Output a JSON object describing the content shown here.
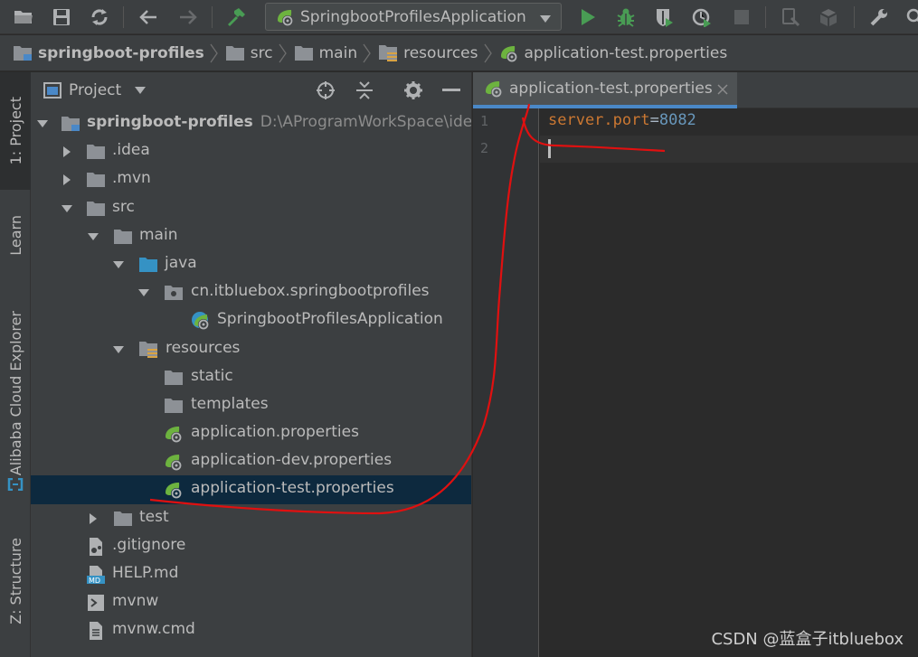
{
  "toolbar": {
    "run_config": "SpringbootProfilesApplication"
  },
  "breadcrumb": [
    "springboot-profiles",
    "src",
    "main",
    "resources",
    "application-test.properties"
  ],
  "tool_stripe": {
    "project_tab": "1: Project",
    "learn_tab": "Learn",
    "alibaba_tab": "Alibaba Cloud Explorer",
    "structure_tab": "Z: Structure"
  },
  "project_panel": {
    "title": "Project",
    "tree": [
      {
        "label": "springboot-profiles",
        "path": "D:\\AProgramWorkSpace\\idea\\s",
        "icon": "module-folder-icon"
      },
      {
        "label": ".idea",
        "icon": "folder-icon"
      },
      {
        "label": ".mvn",
        "icon": "folder-icon"
      },
      {
        "label": "src",
        "icon": "folder-icon"
      },
      {
        "label": "main",
        "icon": "folder-icon"
      },
      {
        "label": "java",
        "icon": "source-folder-icon"
      },
      {
        "label": "cn.itbluebox.springbootprofiles",
        "icon": "package-icon"
      },
      {
        "label": "SpringbootProfilesApplication",
        "icon": "spring-boot-class-icon"
      },
      {
        "label": "resources",
        "icon": "resources-folder-icon"
      },
      {
        "label": "static",
        "icon": "folder-icon"
      },
      {
        "label": "templates",
        "icon": "folder-icon"
      },
      {
        "label": "application.properties",
        "icon": "spring-properties-icon"
      },
      {
        "label": "application-dev.properties",
        "icon": "spring-properties-icon"
      },
      {
        "label": "application-test.properties",
        "icon": "spring-properties-icon"
      },
      {
        "label": "test",
        "icon": "folder-icon"
      },
      {
        "label": ".gitignore",
        "icon": "gitignore-file-icon"
      },
      {
        "label": "HELP.md",
        "icon": "markdown-file-icon"
      },
      {
        "label": "mvnw",
        "icon": "shell-script-icon"
      },
      {
        "label": "mvnw.cmd",
        "icon": "text-file-icon"
      }
    ]
  },
  "editor": {
    "tab_label": "application-test.properties",
    "line_numbers": [
      "1",
      "2"
    ],
    "code": {
      "key": "server.port",
      "eq": "=",
      "value": "8082"
    }
  },
  "watermark": "CSDN @蓝盒子itbluebox",
  "colors": {
    "background": "#2b2b2b",
    "panel": "#3c3f41",
    "selection": "#0d293e",
    "accent_blue": "#4a88c7",
    "run_green": "#499c54",
    "spring_green": "#6db33f",
    "property_key": "#cc7832",
    "number_value": "#6897bb",
    "annotation_red": "#e01010"
  }
}
